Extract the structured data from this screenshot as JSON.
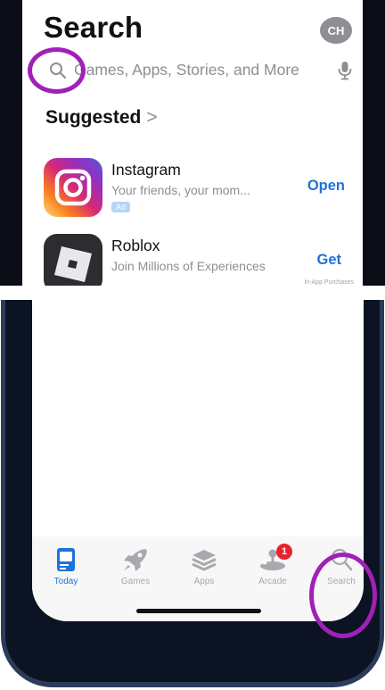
{
  "colors": {
    "accent_blue": "#1e73d8",
    "highlight_ring": "#a020b8",
    "badge_red": "#e8232d",
    "phone_frame": "#0c1322"
  },
  "header": {
    "title": "Search",
    "avatar_initials": "CH"
  },
  "search": {
    "placeholder": "Games, Apps, Stories, and More",
    "left_icon": "search-icon",
    "right_icon": "microphone-icon"
  },
  "suggested": {
    "title": "Suggested",
    "chevron": ">",
    "apps": [
      {
        "name": "Instagram",
        "subtitle": "Your friends, your mom...",
        "badge": "Ad",
        "action": "Open",
        "icon": "instagram-icon"
      },
      {
        "name": "Roblox",
        "subtitle": "Join Millions of Experiences",
        "action": "Get",
        "note": "In-App Purchases",
        "icon": "roblox-icon"
      }
    ]
  },
  "tab_bar": {
    "tabs": [
      {
        "label": "Today",
        "icon": "today-icon",
        "active": true
      },
      {
        "label": "Games",
        "icon": "rocket-icon",
        "active": false
      },
      {
        "label": "Apps",
        "icon": "stack-icon",
        "active": false
      },
      {
        "label": "Arcade",
        "icon": "joystick-icon",
        "active": false,
        "badge": "1"
      },
      {
        "label": "Search",
        "icon": "search-icon",
        "active": false
      }
    ]
  }
}
